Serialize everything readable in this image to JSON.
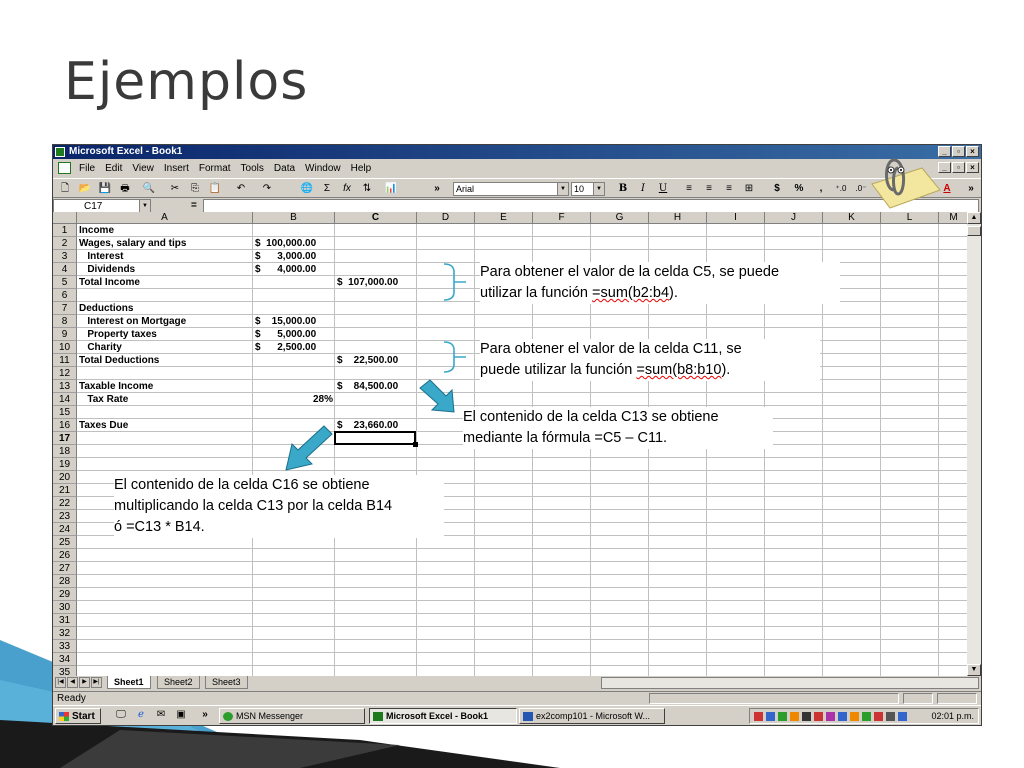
{
  "slide": {
    "title": "Ejemplos"
  },
  "window": {
    "title": "Microsoft Excel - Book1",
    "menus": [
      "File",
      "Edit",
      "View",
      "Insert",
      "Format",
      "Tools",
      "Data",
      "Window",
      "Help"
    ],
    "font_name": "Arial",
    "font_size": "10",
    "toolbar_glyphs": {
      "sum": "Σ",
      "fx": "fx",
      "bold": "B",
      "italic": "I",
      "underline": "U",
      "currency": "$",
      "percent": "%",
      "comma": ",",
      "more": "»"
    },
    "name_box": "C17",
    "formula_eq": "=",
    "formula_value": ""
  },
  "grid": {
    "columns": [
      "A",
      "B",
      "C",
      "D",
      "E",
      "F",
      "G",
      "H",
      "I",
      "J",
      "K",
      "L",
      "M"
    ],
    "active_column": "C",
    "active_row": "17",
    "rows": [
      "1",
      "2",
      "3",
      "4",
      "5",
      "6",
      "7",
      "8",
      "9",
      "10",
      "11",
      "12",
      "13",
      "14",
      "15",
      "16",
      "17",
      "18",
      "19",
      "20",
      "21",
      "22",
      "23",
      "24",
      "25",
      "26",
      "27",
      "28",
      "29",
      "30",
      "31",
      "32",
      "33",
      "34",
      "35"
    ],
    "cells": [
      {
        "row": 1,
        "a": "Income",
        "b": "",
        "c": ""
      },
      {
        "row": 2,
        "a": "Wages, salary and tips",
        "b": "$  100,000.00",
        "c": ""
      },
      {
        "row": 3,
        "a": "   Interest",
        "b": "$      3,000.00",
        "c": ""
      },
      {
        "row": 4,
        "a": "   Dividends",
        "b": "$      4,000.00",
        "c": ""
      },
      {
        "row": 5,
        "a": "Total Income",
        "b": "",
        "c": "$  107,000.00"
      },
      {
        "row": 7,
        "a": "Deductions",
        "b": "",
        "c": ""
      },
      {
        "row": 8,
        "a": "   Interest on Mortgage",
        "b": "$    15,000.00",
        "c": ""
      },
      {
        "row": 9,
        "a": "   Property taxes",
        "b": "$      5,000.00",
        "c": ""
      },
      {
        "row": 10,
        "a": "   Charity",
        "b": "$      2,500.00",
        "c": ""
      },
      {
        "row": 11,
        "a": "Total Deductions",
        "b": "",
        "c": "$    22,500.00"
      },
      {
        "row": 13,
        "a": "Taxable Income",
        "b": "",
        "c": "$    84,500.00"
      },
      {
        "row": 14,
        "a": "   Tax Rate",
        "b": "28%",
        "c": ""
      },
      {
        "row": 16,
        "a": "Taxes Due",
        "b": "",
        "c": "$    23,660.00"
      }
    ],
    "sheets": [
      "Sheet1",
      "Sheet2",
      "Sheet3"
    ],
    "active_sheet": "Sheet1"
  },
  "status": {
    "text": "Ready"
  },
  "taskbar": {
    "start": "Start",
    "buttons": [
      "MSN Messenger",
      "Microsoft Excel - Book1",
      "ex2comp101 - Microsoft W..."
    ],
    "active_button": "Microsoft Excel - Book1",
    "clock": "02:01 p.m."
  },
  "notes": {
    "c5": {
      "line1": "Para obtener el valor de la celda C5, se puede",
      "line2_pre": "utilizar la función ",
      "line2_fx": "=sum(b2:b4",
      "line2_post": ")."
    },
    "c11": {
      "line1": "Para obtener el valor de la celda C11, se",
      "line2_pre": "puede utilizar la función ",
      "line2_fx": "=sum(b8:b10",
      "line2_post": ")."
    },
    "c13": {
      "line1": "El contenido de la celda C13 se obtiene",
      "line2": "mediante la fórmula =C5 – C11."
    },
    "c16": {
      "line1": "El contenido de la celda C16 se obtiene",
      "line2": "multiplicando la celda C13 por la celda B14",
      "line3": "ó =C13 * B14."
    }
  },
  "colors": {
    "titlebar": "#0a246a",
    "arrow": "#3aa8c8",
    "bracket": "#3aa8c8",
    "deco_dark": "#1a1a1a",
    "deco_blue": "#2a8fc4"
  }
}
